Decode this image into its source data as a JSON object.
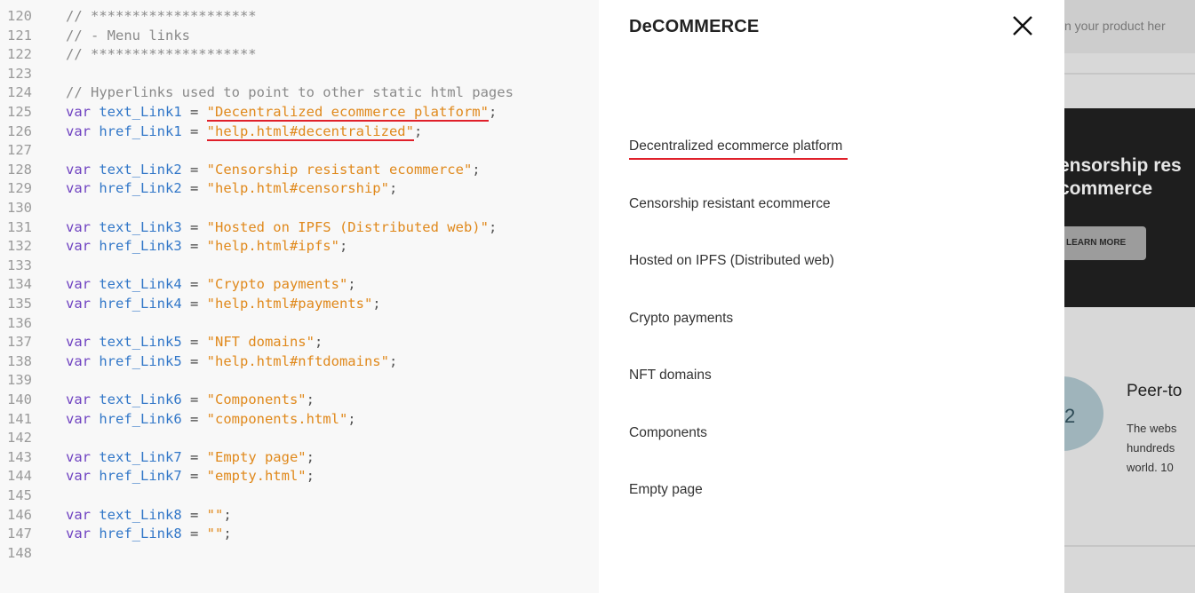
{
  "editor": {
    "lines": [
      {
        "n": "120",
        "tokens": [
          {
            "t": "// ********************",
            "c": "comment"
          }
        ]
      },
      {
        "n": "121",
        "tokens": [
          {
            "t": "// - Menu links",
            "c": "comment"
          }
        ]
      },
      {
        "n": "122",
        "tokens": [
          {
            "t": "// ********************",
            "c": "comment"
          }
        ]
      },
      {
        "n": "123",
        "tokens": []
      },
      {
        "n": "124",
        "tokens": [
          {
            "t": "// Hyperlinks used to point to other static html pages",
            "c": "comment"
          }
        ]
      },
      {
        "n": "125",
        "tokens": [
          {
            "t": "var",
            "c": "keyword"
          },
          {
            "t": " text_Link1",
            "c": "ident"
          },
          {
            "t": " = ",
            "c": "op"
          },
          {
            "t": "\"Decentralized ecommerce platform\"",
            "c": "str",
            "u": true
          },
          {
            "t": ";",
            "c": "punct"
          }
        ]
      },
      {
        "n": "126",
        "tokens": [
          {
            "t": "var",
            "c": "keyword"
          },
          {
            "t": " href_Link1",
            "c": "ident"
          },
          {
            "t": " = ",
            "c": "op"
          },
          {
            "t": "\"help.html#decentralized\"",
            "c": "str",
            "u": true
          },
          {
            "t": ";",
            "c": "punct"
          }
        ]
      },
      {
        "n": "127",
        "tokens": []
      },
      {
        "n": "128",
        "tokens": [
          {
            "t": "var",
            "c": "keyword"
          },
          {
            "t": " text_Link2",
            "c": "ident"
          },
          {
            "t": " = ",
            "c": "op"
          },
          {
            "t": "\"Censorship resistant ecommerce\"",
            "c": "str"
          },
          {
            "t": ";",
            "c": "punct"
          }
        ]
      },
      {
        "n": "129",
        "tokens": [
          {
            "t": "var",
            "c": "keyword"
          },
          {
            "t": " href_Link2",
            "c": "ident"
          },
          {
            "t": " = ",
            "c": "op"
          },
          {
            "t": "\"help.html#censorship\"",
            "c": "str"
          },
          {
            "t": ";",
            "c": "punct"
          }
        ]
      },
      {
        "n": "130",
        "tokens": []
      },
      {
        "n": "131",
        "tokens": [
          {
            "t": "var",
            "c": "keyword"
          },
          {
            "t": " text_Link3",
            "c": "ident"
          },
          {
            "t": " = ",
            "c": "op"
          },
          {
            "t": "\"Hosted on IPFS (Distributed web)\"",
            "c": "str"
          },
          {
            "t": ";",
            "c": "punct"
          }
        ]
      },
      {
        "n": "132",
        "tokens": [
          {
            "t": "var",
            "c": "keyword"
          },
          {
            "t": " href_Link3",
            "c": "ident"
          },
          {
            "t": " = ",
            "c": "op"
          },
          {
            "t": "\"help.html#ipfs\"",
            "c": "str"
          },
          {
            "t": ";",
            "c": "punct"
          }
        ]
      },
      {
        "n": "133",
        "tokens": []
      },
      {
        "n": "134",
        "tokens": [
          {
            "t": "var",
            "c": "keyword"
          },
          {
            "t": " text_Link4",
            "c": "ident"
          },
          {
            "t": " = ",
            "c": "op"
          },
          {
            "t": "\"Crypto payments\"",
            "c": "str"
          },
          {
            "t": ";",
            "c": "punct"
          }
        ]
      },
      {
        "n": "135",
        "tokens": [
          {
            "t": "var",
            "c": "keyword"
          },
          {
            "t": " href_Link4",
            "c": "ident"
          },
          {
            "t": " = ",
            "c": "op"
          },
          {
            "t": "\"help.html#payments\"",
            "c": "str"
          },
          {
            "t": ";",
            "c": "punct"
          }
        ]
      },
      {
        "n": "136",
        "tokens": []
      },
      {
        "n": "137",
        "tokens": [
          {
            "t": "var",
            "c": "keyword"
          },
          {
            "t": " text_Link5",
            "c": "ident"
          },
          {
            "t": " = ",
            "c": "op"
          },
          {
            "t": "\"NFT domains\"",
            "c": "str"
          },
          {
            "t": ";",
            "c": "punct"
          }
        ]
      },
      {
        "n": "138",
        "tokens": [
          {
            "t": "var",
            "c": "keyword"
          },
          {
            "t": " href_Link5",
            "c": "ident"
          },
          {
            "t": " = ",
            "c": "op"
          },
          {
            "t": "\"help.html#nftdomains\"",
            "c": "str"
          },
          {
            "t": ";",
            "c": "punct"
          }
        ]
      },
      {
        "n": "139",
        "tokens": []
      },
      {
        "n": "140",
        "tokens": [
          {
            "t": "var",
            "c": "keyword"
          },
          {
            "t": " text_Link6",
            "c": "ident"
          },
          {
            "t": " = ",
            "c": "op"
          },
          {
            "t": "\"Components\"",
            "c": "str"
          },
          {
            "t": ";",
            "c": "punct"
          }
        ]
      },
      {
        "n": "141",
        "tokens": [
          {
            "t": "var",
            "c": "keyword"
          },
          {
            "t": " href_Link6",
            "c": "ident"
          },
          {
            "t": " = ",
            "c": "op"
          },
          {
            "t": "\"components.html\"",
            "c": "str"
          },
          {
            "t": ";",
            "c": "punct"
          }
        ]
      },
      {
        "n": "142",
        "tokens": []
      },
      {
        "n": "143",
        "tokens": [
          {
            "t": "var",
            "c": "keyword"
          },
          {
            "t": " text_Link7",
            "c": "ident"
          },
          {
            "t": " = ",
            "c": "op"
          },
          {
            "t": "\"Empty page\"",
            "c": "str"
          },
          {
            "t": ";",
            "c": "punct"
          }
        ]
      },
      {
        "n": "144",
        "tokens": [
          {
            "t": "var",
            "c": "keyword"
          },
          {
            "t": " href_Link7",
            "c": "ident"
          },
          {
            "t": " = ",
            "c": "op"
          },
          {
            "t": "\"empty.html\"",
            "c": "str"
          },
          {
            "t": ";",
            "c": "punct"
          }
        ]
      },
      {
        "n": "145",
        "tokens": []
      },
      {
        "n": "146",
        "tokens": [
          {
            "t": "var",
            "c": "keyword"
          },
          {
            "t": " text_Link8",
            "c": "ident"
          },
          {
            "t": " = ",
            "c": "op"
          },
          {
            "t": "\"\"",
            "c": "str"
          },
          {
            "t": ";",
            "c": "punct"
          }
        ]
      },
      {
        "n": "147",
        "tokens": [
          {
            "t": "var",
            "c": "keyword"
          },
          {
            "t": " href_Link8",
            "c": "ident"
          },
          {
            "t": " = ",
            "c": "op"
          },
          {
            "t": "\"\"",
            "c": "str"
          },
          {
            "t": ";",
            "c": "punct"
          }
        ]
      },
      {
        "n": "148",
        "tokens": []
      }
    ]
  },
  "menu": {
    "title": "DeCOMMERCE",
    "close_icon": "close-x-icon",
    "links": [
      {
        "label": "Decentralized ecommerce platform",
        "active": true
      },
      {
        "label": "Censorship resistant ecommerce",
        "active": false
      },
      {
        "label": "Hosted on IPFS (Distributed web)",
        "active": false
      },
      {
        "label": "Crypto payments",
        "active": false
      },
      {
        "label": "NFT domains",
        "active": false
      },
      {
        "label": "Components",
        "active": false
      },
      {
        "label": "Empty page",
        "active": false
      }
    ]
  },
  "background_site": {
    "search_placeholder_fragment": "n your product her",
    "hero_title_line1": "ensorship res",
    "hero_title_line2": "commerce",
    "hero_button": "LEARN MORE",
    "step_number": "2",
    "feature_title": "Peer-to",
    "feature_text": "The webs\nhundreds\nworld. 10"
  },
  "colors": {
    "underline_red": "#e0202a",
    "string_orange": "#e0891c",
    "keyword_purple": "#6f42c1",
    "identifier_blue": "#3277c8",
    "hero_dark": "#1e1e1e"
  }
}
